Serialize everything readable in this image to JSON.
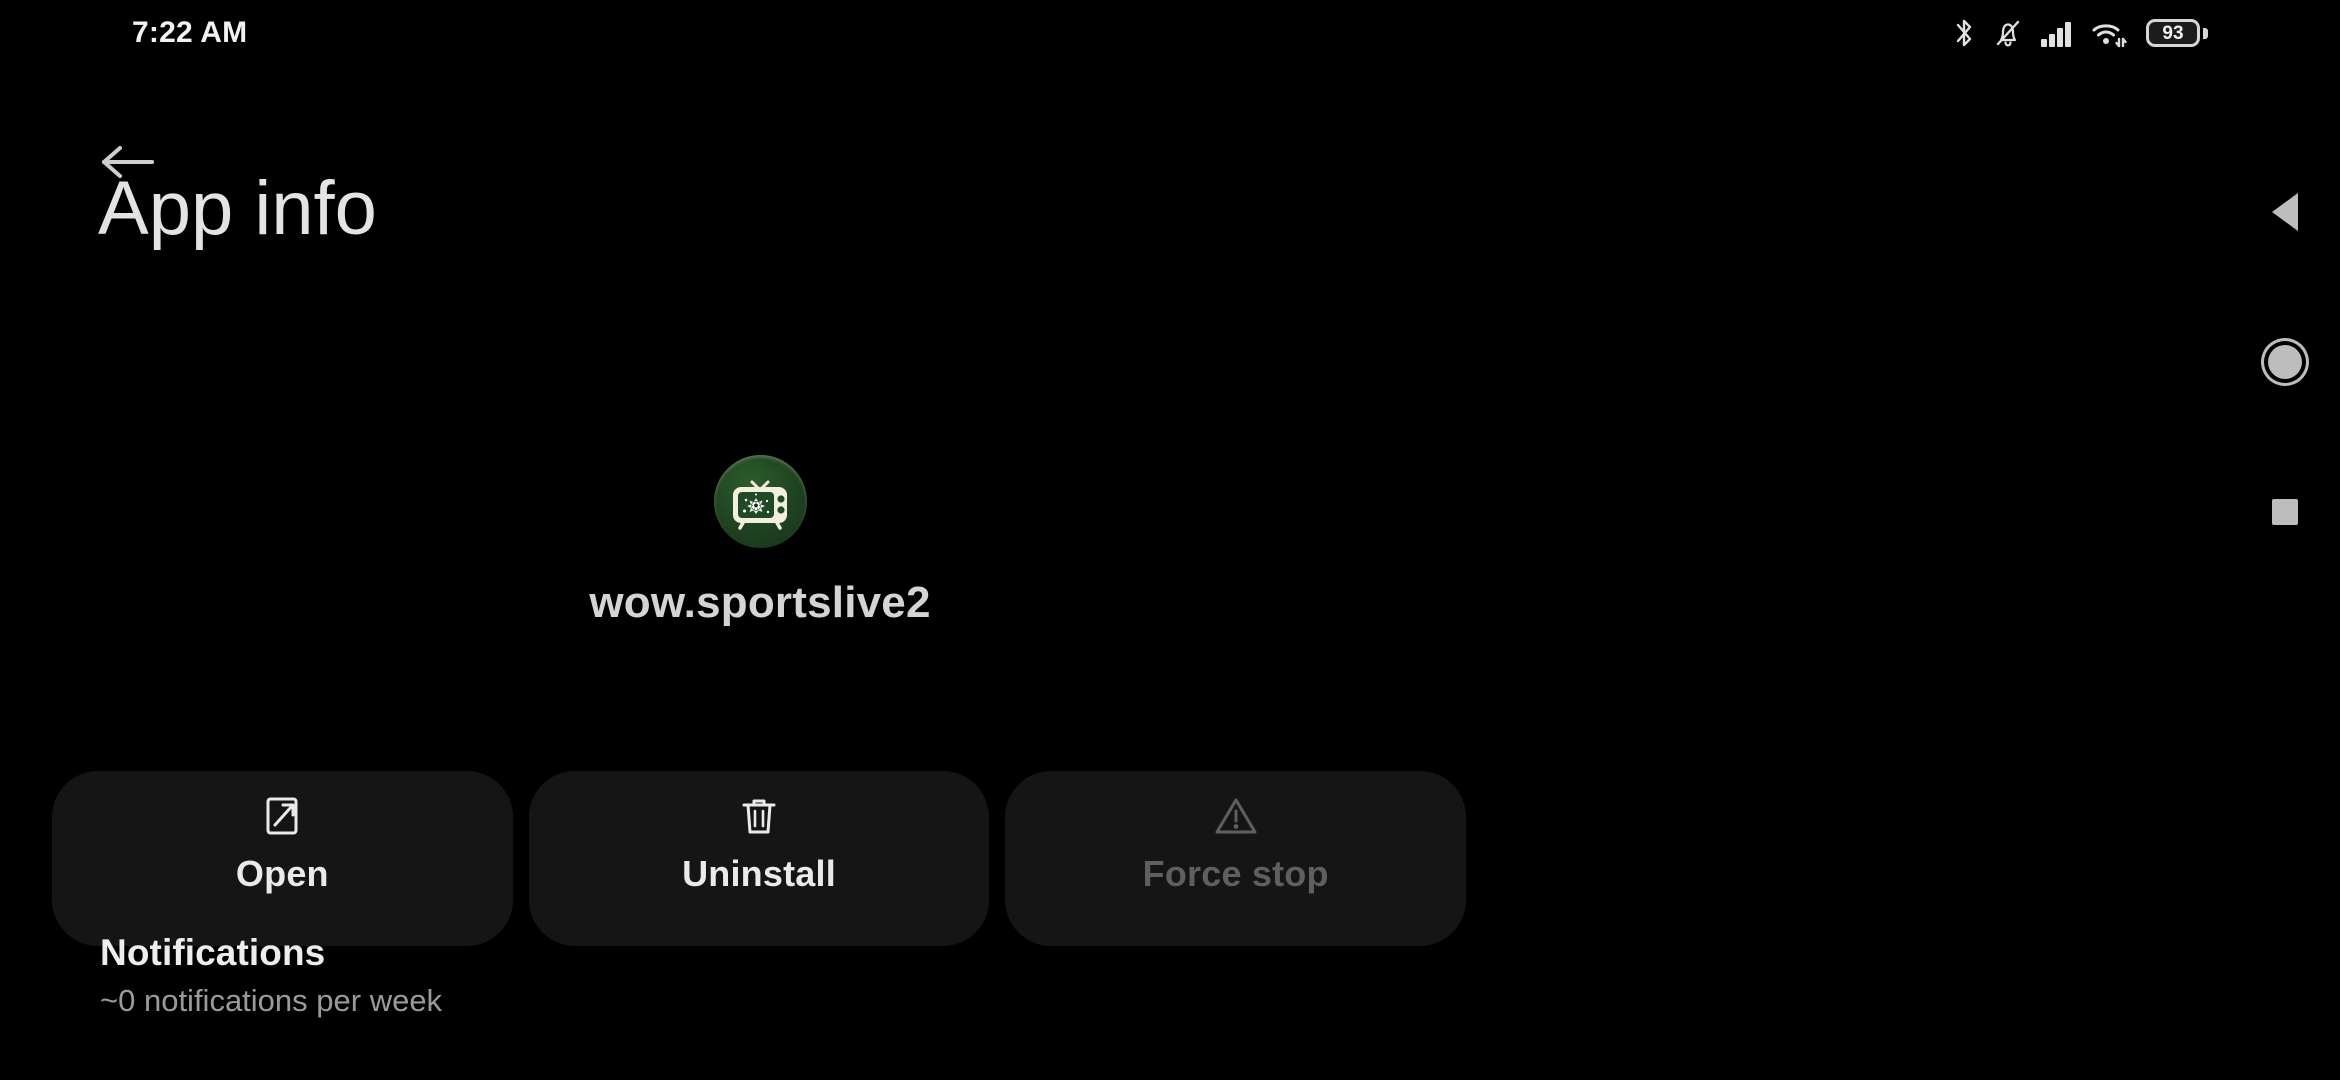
{
  "status_bar": {
    "time": "7:22 AM",
    "battery_percent": "93",
    "icons": [
      "bluetooth-icon",
      "notifications-silenced-icon",
      "cellular-signal-icon",
      "wifi-icon",
      "battery-icon"
    ]
  },
  "header": {
    "back_label": "Back",
    "title": "App info"
  },
  "app": {
    "name": "wow.sportslive2",
    "icon_name": "sports-tv-app-icon",
    "icon_colors": {
      "circle_bg": "#1f4320",
      "tv_body": "#f2efdf",
      "tv_screen": "#1f4a23",
      "splatter": "#ffffff"
    }
  },
  "actions": [
    {
      "label": "Open",
      "icon": "launch-icon",
      "disabled": false
    },
    {
      "label": "Uninstall",
      "icon": "trash-icon",
      "disabled": false
    },
    {
      "label": "Force stop",
      "icon": "warning-icon",
      "disabled": true
    }
  ],
  "settings": [
    {
      "title": "Notifications",
      "subtitle": "~0 notifications per week"
    }
  ],
  "nav_bar": {
    "back_label": "Back",
    "home_label": "Home",
    "recents_label": "Recent apps"
  }
}
